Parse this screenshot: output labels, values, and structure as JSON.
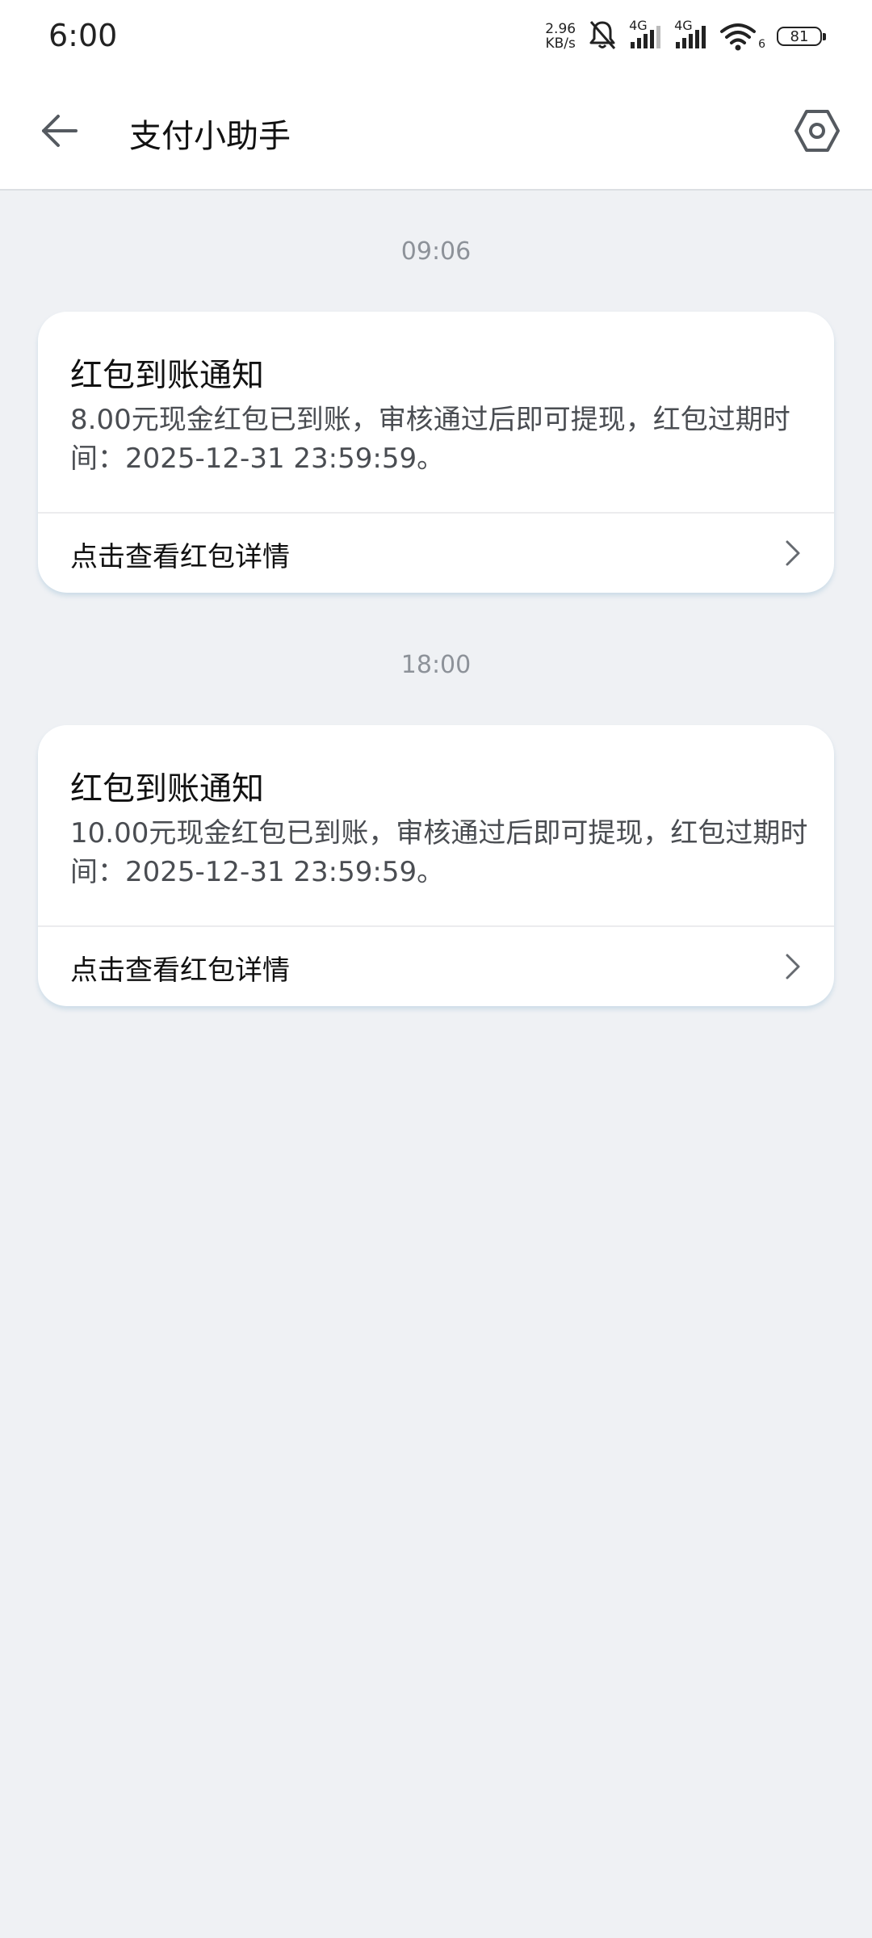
{
  "status_bar": {
    "time": "6:00",
    "net_speed_value": "2.96",
    "net_speed_unit": "KB/s",
    "sim1_label": "4G",
    "sim2_label": "4G",
    "wifi_label": "6",
    "battery": "81"
  },
  "header": {
    "title": "支付小助手"
  },
  "messages": [
    {
      "time": "09:06",
      "title": "红包到账通知",
      "body": "8.00元现金红包已到账，审核通过后即可提现，红包过期时间：2025-12-31 23:59:59。",
      "link_label": "点击查看红包详情"
    },
    {
      "time": "18:00",
      "title": "红包到账通知",
      "body": "10.00元现金红包已到账，审核通过后即可提现，红包过期时间：2025-12-31 23:59:59。",
      "link_label": "点击查看红包详情"
    }
  ],
  "colors": {
    "background": "#eff1f4",
    "card": "#ffffff",
    "timestamp": "#8d9299"
  }
}
